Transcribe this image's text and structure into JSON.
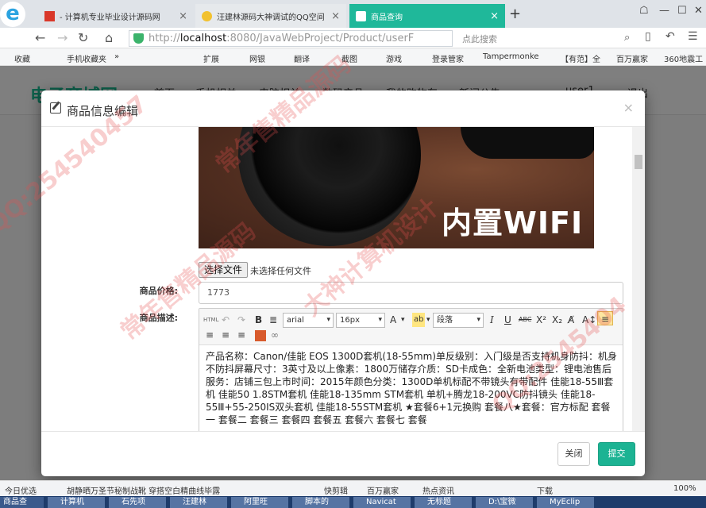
{
  "browser": {
    "tabs": [
      {
        "label": "- 计算机专业毕业设计源码网",
        "active": false
      },
      {
        "label": "汪建林源码大神调试的QQ空间",
        "active": false
      },
      {
        "label": "商品查询",
        "active": true
      }
    ],
    "url_prefix": "http://",
    "url_host": "localhost",
    "url_rest": ":8080/JavaWebProject/Product/userF",
    "search_placeholder": "点此搜索",
    "bookmarks": [
      "收藏",
      "手机收藏夹",
      "»",
      "扩展",
      "网银",
      "翻译",
      "截图",
      "游戏",
      "登录管家",
      "Tampermonke",
      "【有范】全",
      "百万赢家",
      "360地震工"
    ]
  },
  "site": {
    "brand": "电子商城网",
    "nav": [
      "首页",
      "手机相关",
      "电脑相关",
      "数码产品",
      "我的购物车",
      "新闻公告"
    ],
    "user": "user1",
    "logout": "退出"
  },
  "modal": {
    "title": "商品信息编辑",
    "image_text": "内置WIFI",
    "file_button": "选择文件",
    "file_status": "未选择任何文件",
    "price_label": "商品价格:",
    "price_value": "1773",
    "desc_label": "商品描述:",
    "toolbar": {
      "html": "HTML",
      "bold": "B",
      "font_family": "arial",
      "font_size": "16px",
      "font_color": "A",
      "paragraph": "段落",
      "italic": "I",
      "underline": "U",
      "strike": "ABC"
    },
    "description": "产品名称：Canon/佳能 EOS 1300D套机(18-55mm)单反级别：入门级是否支持机身防抖：机身不防抖屏幕尺寸：3英寸及以上像素：1800万储存介质：SD卡成色：全新电池类型：锂电池售后服务：店铺三包上市时间：2015年颜色分类：1300D单机标配不带镜头有带配件 佳能18-55Ⅲ套机 佳能50 1.8STM套机 佳能18-135mm STM套机 单机+腾龙18-200VC防抖镜头 佳能18-55Ⅲ+55-250IS双头套机 佳能18-55STM套机 ★套餐6+1元换购 套餐八★套餐：官方标配 套餐一 套餐二 套餐三 套餐四 套餐五 套餐六 套餐七 套餐",
    "close_button": "关闭",
    "submit_button": "提交"
  },
  "statusbar": {
    "items": [
      "今日优选",
      "胡静晒万圣节秘制战靴 穿搭空白精曲线毕露",
      "快剪辑",
      "百万赢家",
      "热点资讯",
      "下载",
      "100%"
    ]
  },
  "taskbar": {
    "items": [
      "商品查",
      "计算机",
      "石先项",
      "汪建林",
      "阿里旺",
      "脚本的",
      "Navicat",
      "无标题",
      "D:\\宝微",
      "MyEclip"
    ]
  },
  "watermarks": [
    "QQ:254540457",
    "常年售精品源码",
    "大神计算机设计",
    "QQ:2545404",
    "常年售精品源码"
  ],
  "colors": {
    "accent": "#1cb393",
    "active_tab": "#1fb89a",
    "brand": "#19c196"
  }
}
